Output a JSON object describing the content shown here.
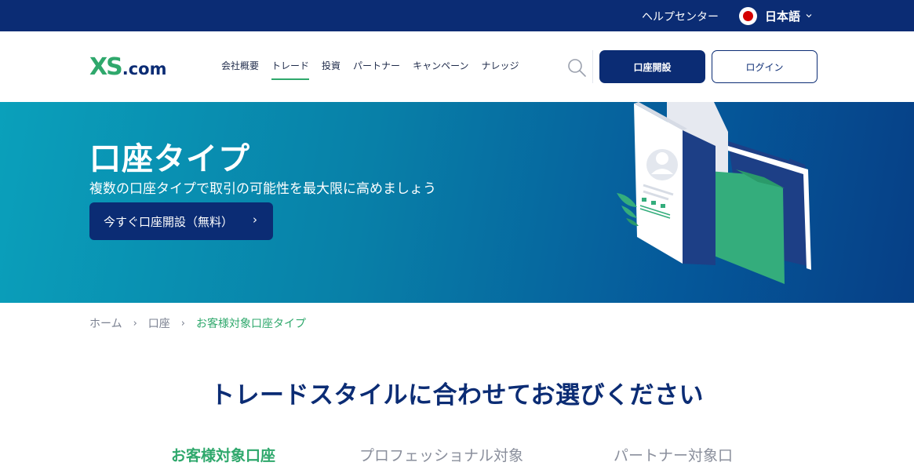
{
  "topbar": {
    "help_center": "ヘルプセンター",
    "language": "日本語"
  },
  "header": {
    "logo_mark": "XS",
    "logo_suffix": ".com",
    "nav": [
      {
        "label": "会社概要",
        "active": false
      },
      {
        "label": "トレード",
        "active": true
      },
      {
        "label": "投資",
        "active": false
      },
      {
        "label": "パートナー",
        "active": false
      },
      {
        "label": "キャンペーン",
        "active": false
      },
      {
        "label": "ナレッジ",
        "active": false
      }
    ],
    "open_account_label": "口座開設",
    "login_label": "ログイン"
  },
  "hero": {
    "title": "口座タイプ",
    "subtitle": "複数の口座タイプで取引の可能性を最大限に高めましょう",
    "cta_label": "今すぐ口座開設（無料）",
    "cta_arrow": "›"
  },
  "breadcrumb": {
    "home": "ホーム",
    "account": "口座",
    "current": "お客様対象口座タイプ",
    "separator": "›"
  },
  "section": {
    "title": "トレードスタイルに合わせてお選びください",
    "tabs": [
      {
        "label": "お客様対象口座",
        "active": true
      },
      {
        "label": "プロフェッショナル対象",
        "active": false
      },
      {
        "label": "パートナー対象口",
        "active": false
      }
    ]
  },
  "colors": {
    "brand_navy": "#0b2c74",
    "brand_green": "#2fa86c",
    "hero_start": "#0aa0bb",
    "hero_end": "#063f86"
  },
  "icons": {
    "flag": "japan-flag-icon",
    "language_chevron": "chevron-down-icon",
    "search": "search-icon",
    "breadcrumb_separator": "chevron-right-icon"
  }
}
